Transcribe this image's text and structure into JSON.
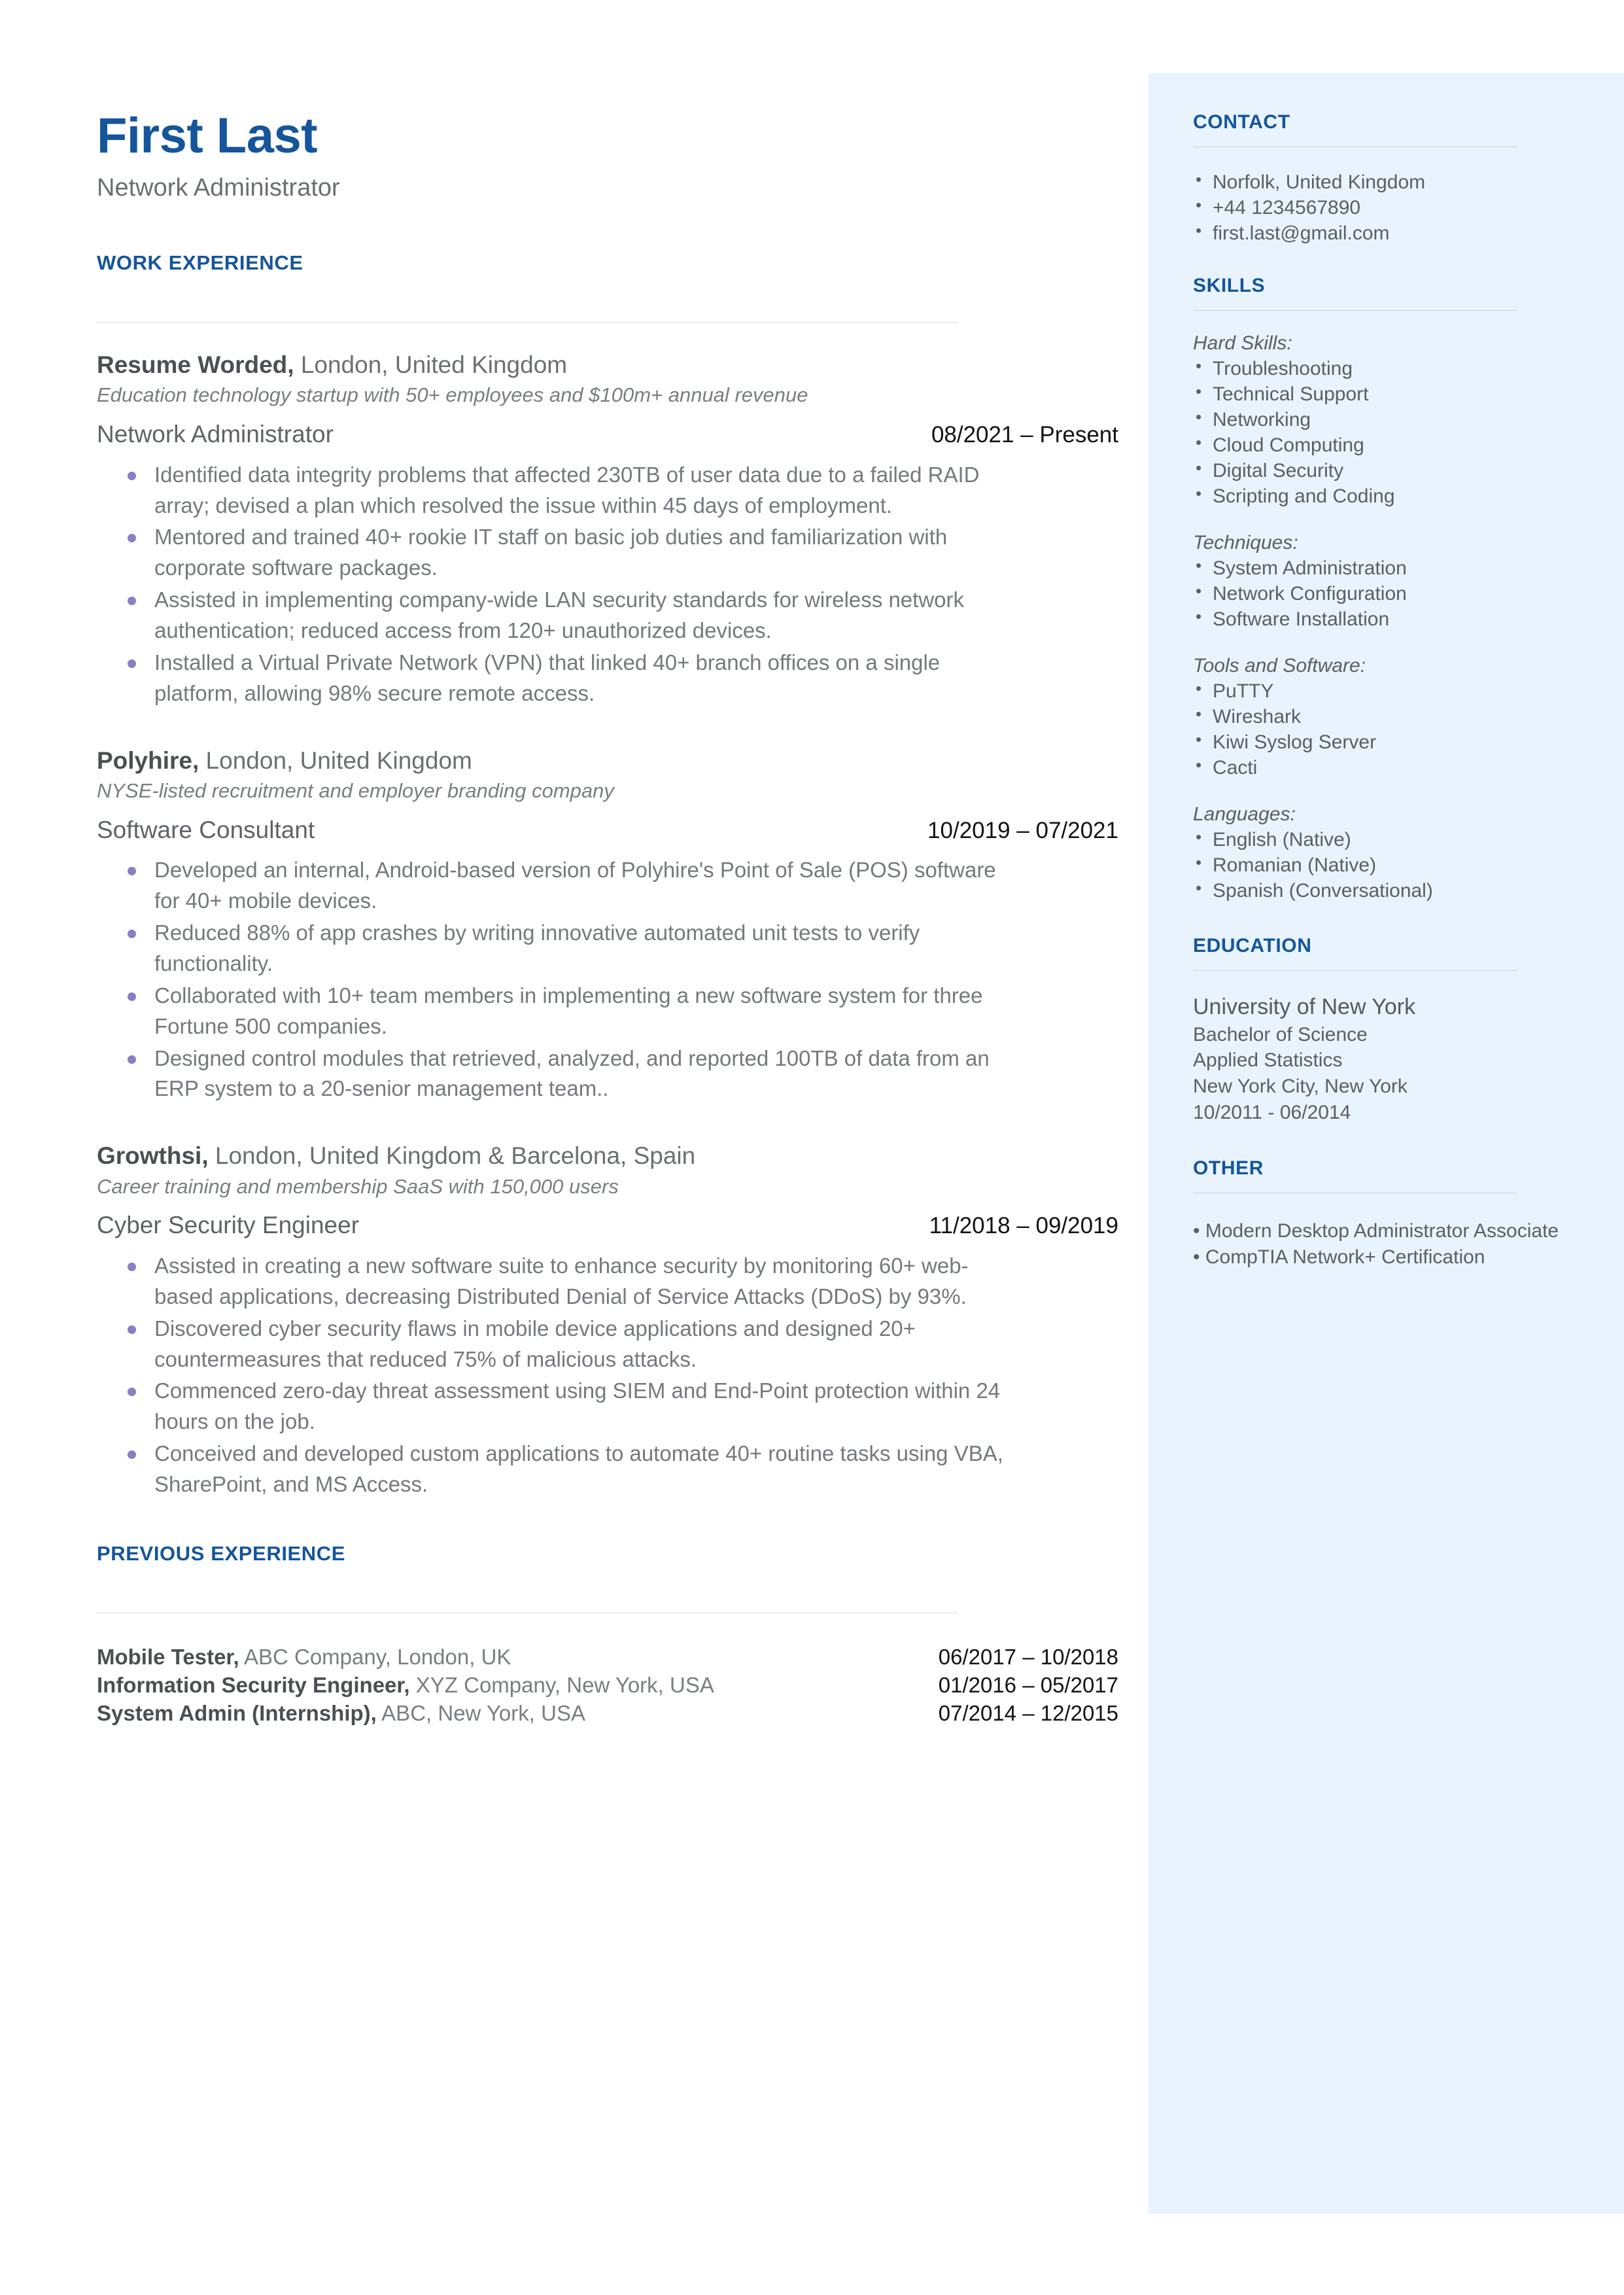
{
  "colors": {
    "accent_blue": "#15559b",
    "sidebar_bg": "#e8f3fd",
    "bullet_purple": "#8a7ec4",
    "body_gray": "#75797d"
  },
  "header": {
    "name": "First Last",
    "role": "Network Administrator"
  },
  "main": {
    "work_experience_heading": "WORK EXPERIENCE",
    "previous_experience_heading": "PREVIOUS EXPERIENCE",
    "jobs": [
      {
        "company": "Resume Worded,",
        "location": " London, United Kingdom",
        "description": "Education technology startup with 50+ employees and $100m+ annual revenue",
        "title": "Network Administrator",
        "dates": "08/2021 – Present",
        "bullets": [
          "Identified data integrity problems that affected 230TB of user data due to a failed RAID array; devised a plan which resolved the issue within 45 days of employment.",
          "Mentored and trained 40+ rookie IT staff on basic job duties and familiarization with corporate software packages.",
          "Assisted in implementing company-wide LAN security standards for wireless network authentication; reduced access from 120+ unauthorized devices.",
          "Installed a Virtual Private Network (VPN) that linked 40+ branch offices on a single platform, allowing 98% secure remote access."
        ]
      },
      {
        "company": "Polyhire,",
        "location": " London, United Kingdom",
        "description": "NYSE-listed recruitment and employer branding company",
        "title": "Software Consultant",
        "dates": "10/2019 – 07/2021",
        "bullets": [
          "Developed an internal, Android-based version of Polyhire's Point of Sale (POS) software for 40+ mobile devices.",
          "Reduced 88% of app crashes by writing innovative automated unit tests to verify functionality.",
          "Collaborated with 10+ team members in implementing a new software system for three Fortune 500 companies.",
          "Designed control modules that retrieved, analyzed, and reported 100TB of data from an ERP system to a 20-senior management team.."
        ]
      },
      {
        "company": "Growthsi,",
        "location": " London, United Kingdom & Barcelona, Spain",
        "description": "Career training and membership SaaS with 150,000 users",
        "title": "Cyber Security Engineer",
        "dates": "11/2018 – 09/2019",
        "bullets": [
          "Assisted in creating a new software suite to enhance security by monitoring 60+ web-based applications, decreasing Distributed Denial of Service Attacks (DDoS) by 93%.",
          "Discovered cyber security flaws in mobile device applications and designed 20+ countermeasures that reduced 75% of malicious attacks.",
          "Commenced zero-day threat assessment using SIEM and End-Point protection within 24 hours on the job.",
          "Conceived and developed custom applications to automate 40+ routine tasks using VBA, SharePoint, and MS Access."
        ]
      }
    ],
    "previous_experience": [
      {
        "title": "Mobile Tester,",
        "detail": " ABC Company, London, UK",
        "dates": "06/2017 – 10/2018"
      },
      {
        "title": "Information Security Engineer,",
        "detail": " XYZ Company, New York, USA",
        "dates": "01/2016 – 05/2017"
      },
      {
        "title": "System Admin (Internship),",
        "detail": " ABC, New York, USA",
        "dates": "07/2014 – 12/2015"
      }
    ]
  },
  "sidebar": {
    "contact_heading": "CONTACT",
    "contact_items": [
      " Norfolk, United Kingdom",
      "+44 1234567890",
      "first.last@gmail.com"
    ],
    "skills_heading": "SKILLS",
    "skills_groups": [
      {
        "label": "Hard Skills:",
        "items": [
          "Troubleshooting",
          "Technical Support",
          "Networking",
          "Cloud Computing",
          "Digital Security",
          "Scripting and Coding"
        ]
      },
      {
        "label": "Techniques:",
        "items": [
          "System Administration",
          "Network Configuration",
          "Software Installation"
        ]
      },
      {
        "label": "Tools and Software:",
        "items": [
          "PuTTY",
          "Wireshark",
          "Kiwi Syslog Server",
          "Cacti"
        ]
      },
      {
        "label": "Languages:",
        "items": [
          "English (Native)",
          "Romanian (Native)",
          "Spanish (Conversational)"
        ]
      }
    ],
    "education_heading": "EDUCATION",
    "education": {
      "school": "University of New York",
      "degree": "Bachelor of Science",
      "field": "Applied Statistics",
      "location": "New York City, New York",
      "dates": "10/2011 - 06/2014"
    },
    "other_heading": "OTHER",
    "other_items": [
      " Modern Desktop Administrator Associate",
      "  CompTIA Network+ Certification"
    ]
  }
}
